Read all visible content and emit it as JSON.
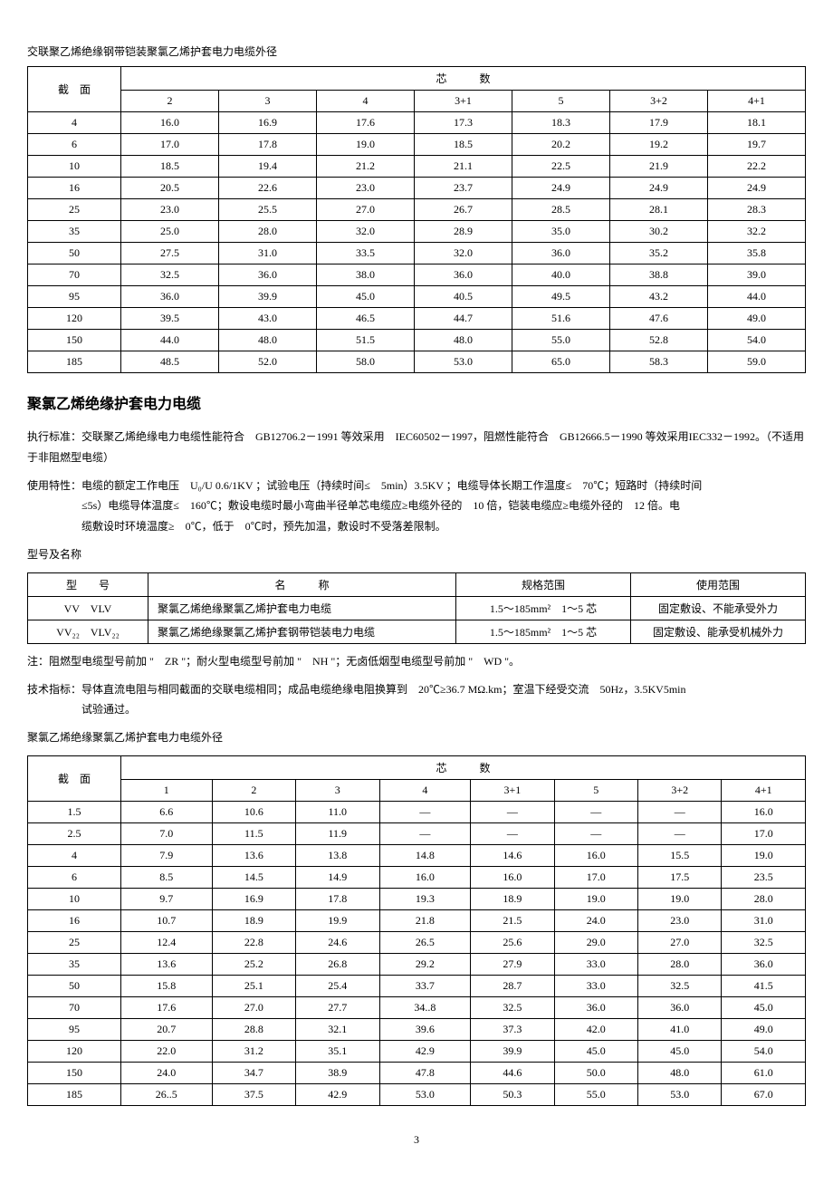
{
  "table1": {
    "title": "交联聚乙烯绝缘钢带铠装聚氯乙烯护套电力电缆外径",
    "row_header": "截　面",
    "col_group_header": "芯　　　数",
    "cols": [
      "2",
      "3",
      "4",
      "3+1",
      "5",
      "3+2",
      "4+1"
    ],
    "rows": [
      {
        "h": "4",
        "v": [
          "16.0",
          "16.9",
          "17.6",
          "17.3",
          "18.3",
          "17.9",
          "18.1"
        ]
      },
      {
        "h": "6",
        "v": [
          "17.0",
          "17.8",
          "19.0",
          "18.5",
          "20.2",
          "19.2",
          "19.7"
        ]
      },
      {
        "h": "10",
        "v": [
          "18.5",
          "19.4",
          "21.2",
          "21.1",
          "22.5",
          "21.9",
          "22.2"
        ]
      },
      {
        "h": "16",
        "v": [
          "20.5",
          "22.6",
          "23.0",
          "23.7",
          "24.9",
          "24.9",
          "24.9"
        ]
      },
      {
        "h": "25",
        "v": [
          "23.0",
          "25.5",
          "27.0",
          "26.7",
          "28.5",
          "28.1",
          "28.3"
        ]
      },
      {
        "h": "35",
        "v": [
          "25.0",
          "28.0",
          "32.0",
          "28.9",
          "35.0",
          "30.2",
          "32.2"
        ]
      },
      {
        "h": "50",
        "v": [
          "27.5",
          "31.0",
          "33.5",
          "32.0",
          "36.0",
          "35.2",
          "35.8"
        ]
      },
      {
        "h": "70",
        "v": [
          "32.5",
          "36.0",
          "38.0",
          "36.0",
          "40.0",
          "38.8",
          "39.0"
        ]
      },
      {
        "h": "95",
        "v": [
          "36.0",
          "39.9",
          "45.0",
          "40.5",
          "49.5",
          "43.2",
          "44.0"
        ]
      },
      {
        "h": "120",
        "v": [
          "39.5",
          "43.0",
          "46.5",
          "44.7",
          "51.6",
          "47.6",
          "49.0"
        ]
      },
      {
        "h": "150",
        "v": [
          "44.0",
          "48.0",
          "51.5",
          "48.0",
          "55.0",
          "52.8",
          "54.0"
        ]
      },
      {
        "h": "185",
        "v": [
          "48.5",
          "52.0",
          "58.0",
          "53.0",
          "65.0",
          "58.3",
          "59.0"
        ]
      }
    ]
  },
  "section2": {
    "title": "聚氯乙烯绝缘护套电力电缆",
    "p1": "执行标准：交联聚乙烯绝缘电力电缆性能符合　GB12706.2－1991 等效采用　IEC60502－1997，阻燃性能符合　GB12666.5－1990 等效采用IEC332－1992。（不适用于非阻燃型电缆）",
    "p2a": "使用特性：电缆的额定工作电压　U₀/U 0.6/1KV ；试验电压（持续时间≤　5min）3.5KV ；电缆导体长期工作温度≤　70℃；短路时（持续时间",
    "p2b": "≤5s）电缆导体温度≤　160℃；敷设电缆时最小弯曲半径单芯电缆应≥电缆外径的　10 倍，铠装电缆应≥电缆外径的　12 倍。电",
    "p2c": "缆敷设时环境温度≥　0℃，低于　0℃时，预先加温，敷设时不受落差限制。",
    "p3": "型号及名称"
  },
  "table2": {
    "headers": {
      "type": "型　　号",
      "name": "名　　　称",
      "spec": "规格范围",
      "use": "使用范围"
    },
    "rows": [
      {
        "type": "VV　VLV",
        "name": "聚氯乙烯绝缘聚氯乙烯护套电力电缆",
        "spec": "1.5～185mm²　1～5 芯",
        "use": "固定敷设、不能承受外力"
      },
      {
        "type": "VV₂₂　VLV₂₂",
        "name": "聚氯乙烯绝缘聚氯乙烯护套钢带铠装电力电缆",
        "spec": "1.5～185mm²　1～5 芯",
        "use": "固定敷设、能承受机械外力"
      }
    ]
  },
  "section3": {
    "p1": "注：阻燃型电缆型号前加 \"　ZR \"；耐火型电缆型号前加 \"　NH \"；无卤低烟型电缆型号前加 \"　WD \"。",
    "p2a": "技术指标：导体直流电阻与相同截面的交联电缆相同；成品电缆绝缘电阻换算到　20℃≥36.7 MΩ.km；室温下经受交流　50Hz，3.5KV5min",
    "p2b": "试验通过。",
    "p3": "聚氯乙烯绝缘聚氯乙烯护套电力电缆外径"
  },
  "table3": {
    "row_header": "截　面",
    "col_group_header": "芯　　　数",
    "cols": [
      "1",
      "2",
      "3",
      "4",
      "3+1",
      "5",
      "3+2",
      "4+1"
    ],
    "rows": [
      {
        "h": "1.5",
        "v": [
          "6.6",
          "10.6",
          "11.0",
          "—",
          "—",
          "—",
          "—",
          "16.0"
        ]
      },
      {
        "h": "2.5",
        "v": [
          "7.0",
          "11.5",
          "11.9",
          "—",
          "—",
          "—",
          "—",
          "17.0"
        ]
      },
      {
        "h": "4",
        "v": [
          "7.9",
          "13.6",
          "13.8",
          "14.8",
          "14.6",
          "16.0",
          "15.5",
          "19.0"
        ]
      },
      {
        "h": "6",
        "v": [
          "8.5",
          "14.5",
          "14.9",
          "16.0",
          "16.0",
          "17.0",
          "17.5",
          "23.5"
        ]
      },
      {
        "h": "10",
        "v": [
          "9.7",
          "16.9",
          "17.8",
          "19.3",
          "18.9",
          "19.0",
          "19.0",
          "28.0"
        ]
      },
      {
        "h": "16",
        "v": [
          "10.7",
          "18.9",
          "19.9",
          "21.8",
          "21.5",
          "24.0",
          "23.0",
          "31.0"
        ]
      },
      {
        "h": "25",
        "v": [
          "12.4",
          "22.8",
          "24.6",
          "26.5",
          "25.6",
          "29.0",
          "27.0",
          "32.5"
        ]
      },
      {
        "h": "35",
        "v": [
          "13.6",
          "25.2",
          "26.8",
          "29.2",
          "27.9",
          "33.0",
          "28.0",
          "36.0"
        ]
      },
      {
        "h": "50",
        "v": [
          "15.8",
          "25.1",
          "25.4",
          "33.7",
          "28.7",
          "33.0",
          "32.5",
          "41.5"
        ]
      },
      {
        "h": "70",
        "v": [
          "17.6",
          "27.0",
          "27.7",
          "34..8",
          "32.5",
          "36.0",
          "36.0",
          "45.0"
        ]
      },
      {
        "h": "95",
        "v": [
          "20.7",
          "28.8",
          "32.1",
          "39.6",
          "37.3",
          "42.0",
          "41.0",
          "49.0"
        ]
      },
      {
        "h": "120",
        "v": [
          "22.0",
          "31.2",
          "35.1",
          "42.9",
          "39.9",
          "45.0",
          "45.0",
          "54.0"
        ]
      },
      {
        "h": "150",
        "v": [
          "24.0",
          "34.7",
          "38.9",
          "47.8",
          "44.6",
          "50.0",
          "48.0",
          "61.0"
        ]
      },
      {
        "h": "185",
        "v": [
          "26..5",
          "37.5",
          "42.9",
          "53.0",
          "50.3",
          "55.0",
          "53.0",
          "67.0"
        ]
      }
    ]
  },
  "page_number": "3"
}
